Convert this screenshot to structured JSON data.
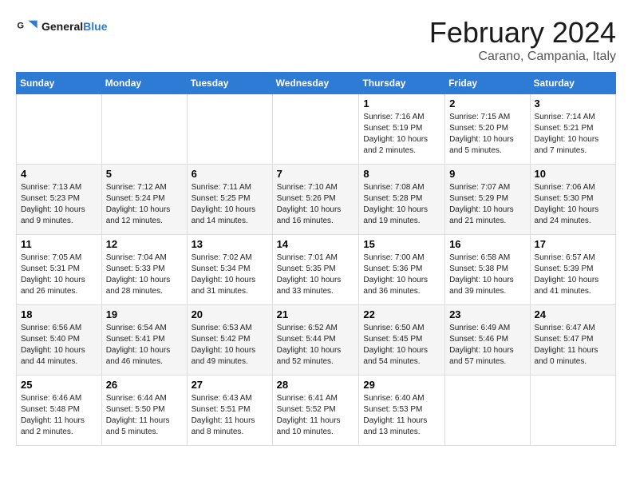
{
  "logo": {
    "text_general": "General",
    "text_blue": "Blue"
  },
  "title": "February 2024",
  "subtitle": "Carano, Campania, Italy",
  "weekdays": [
    "Sunday",
    "Monday",
    "Tuesday",
    "Wednesday",
    "Thursday",
    "Friday",
    "Saturday"
  ],
  "weeks": [
    [
      {
        "num": "",
        "detail": ""
      },
      {
        "num": "",
        "detail": ""
      },
      {
        "num": "",
        "detail": ""
      },
      {
        "num": "",
        "detail": ""
      },
      {
        "num": "1",
        "detail": "Sunrise: 7:16 AM\nSunset: 5:19 PM\nDaylight: 10 hours\nand 2 minutes."
      },
      {
        "num": "2",
        "detail": "Sunrise: 7:15 AM\nSunset: 5:20 PM\nDaylight: 10 hours\nand 5 minutes."
      },
      {
        "num": "3",
        "detail": "Sunrise: 7:14 AM\nSunset: 5:21 PM\nDaylight: 10 hours\nand 7 minutes."
      }
    ],
    [
      {
        "num": "4",
        "detail": "Sunrise: 7:13 AM\nSunset: 5:23 PM\nDaylight: 10 hours\nand 9 minutes."
      },
      {
        "num": "5",
        "detail": "Sunrise: 7:12 AM\nSunset: 5:24 PM\nDaylight: 10 hours\nand 12 minutes."
      },
      {
        "num": "6",
        "detail": "Sunrise: 7:11 AM\nSunset: 5:25 PM\nDaylight: 10 hours\nand 14 minutes."
      },
      {
        "num": "7",
        "detail": "Sunrise: 7:10 AM\nSunset: 5:26 PM\nDaylight: 10 hours\nand 16 minutes."
      },
      {
        "num": "8",
        "detail": "Sunrise: 7:08 AM\nSunset: 5:28 PM\nDaylight: 10 hours\nand 19 minutes."
      },
      {
        "num": "9",
        "detail": "Sunrise: 7:07 AM\nSunset: 5:29 PM\nDaylight: 10 hours\nand 21 minutes."
      },
      {
        "num": "10",
        "detail": "Sunrise: 7:06 AM\nSunset: 5:30 PM\nDaylight: 10 hours\nand 24 minutes."
      }
    ],
    [
      {
        "num": "11",
        "detail": "Sunrise: 7:05 AM\nSunset: 5:31 PM\nDaylight: 10 hours\nand 26 minutes."
      },
      {
        "num": "12",
        "detail": "Sunrise: 7:04 AM\nSunset: 5:33 PM\nDaylight: 10 hours\nand 28 minutes."
      },
      {
        "num": "13",
        "detail": "Sunrise: 7:02 AM\nSunset: 5:34 PM\nDaylight: 10 hours\nand 31 minutes."
      },
      {
        "num": "14",
        "detail": "Sunrise: 7:01 AM\nSunset: 5:35 PM\nDaylight: 10 hours\nand 33 minutes."
      },
      {
        "num": "15",
        "detail": "Sunrise: 7:00 AM\nSunset: 5:36 PM\nDaylight: 10 hours\nand 36 minutes."
      },
      {
        "num": "16",
        "detail": "Sunrise: 6:58 AM\nSunset: 5:38 PM\nDaylight: 10 hours\nand 39 minutes."
      },
      {
        "num": "17",
        "detail": "Sunrise: 6:57 AM\nSunset: 5:39 PM\nDaylight: 10 hours\nand 41 minutes."
      }
    ],
    [
      {
        "num": "18",
        "detail": "Sunrise: 6:56 AM\nSunset: 5:40 PM\nDaylight: 10 hours\nand 44 minutes."
      },
      {
        "num": "19",
        "detail": "Sunrise: 6:54 AM\nSunset: 5:41 PM\nDaylight: 10 hours\nand 46 minutes."
      },
      {
        "num": "20",
        "detail": "Sunrise: 6:53 AM\nSunset: 5:42 PM\nDaylight: 10 hours\nand 49 minutes."
      },
      {
        "num": "21",
        "detail": "Sunrise: 6:52 AM\nSunset: 5:44 PM\nDaylight: 10 hours\nand 52 minutes."
      },
      {
        "num": "22",
        "detail": "Sunrise: 6:50 AM\nSunset: 5:45 PM\nDaylight: 10 hours\nand 54 minutes."
      },
      {
        "num": "23",
        "detail": "Sunrise: 6:49 AM\nSunset: 5:46 PM\nDaylight: 10 hours\nand 57 minutes."
      },
      {
        "num": "24",
        "detail": "Sunrise: 6:47 AM\nSunset: 5:47 PM\nDaylight: 11 hours\nand 0 minutes."
      }
    ],
    [
      {
        "num": "25",
        "detail": "Sunrise: 6:46 AM\nSunset: 5:48 PM\nDaylight: 11 hours\nand 2 minutes."
      },
      {
        "num": "26",
        "detail": "Sunrise: 6:44 AM\nSunset: 5:50 PM\nDaylight: 11 hours\nand 5 minutes."
      },
      {
        "num": "27",
        "detail": "Sunrise: 6:43 AM\nSunset: 5:51 PM\nDaylight: 11 hours\nand 8 minutes."
      },
      {
        "num": "28",
        "detail": "Sunrise: 6:41 AM\nSunset: 5:52 PM\nDaylight: 11 hours\nand 10 minutes."
      },
      {
        "num": "29",
        "detail": "Sunrise: 6:40 AM\nSunset: 5:53 PM\nDaylight: 11 hours\nand 13 minutes."
      },
      {
        "num": "",
        "detail": ""
      },
      {
        "num": "",
        "detail": ""
      }
    ]
  ]
}
